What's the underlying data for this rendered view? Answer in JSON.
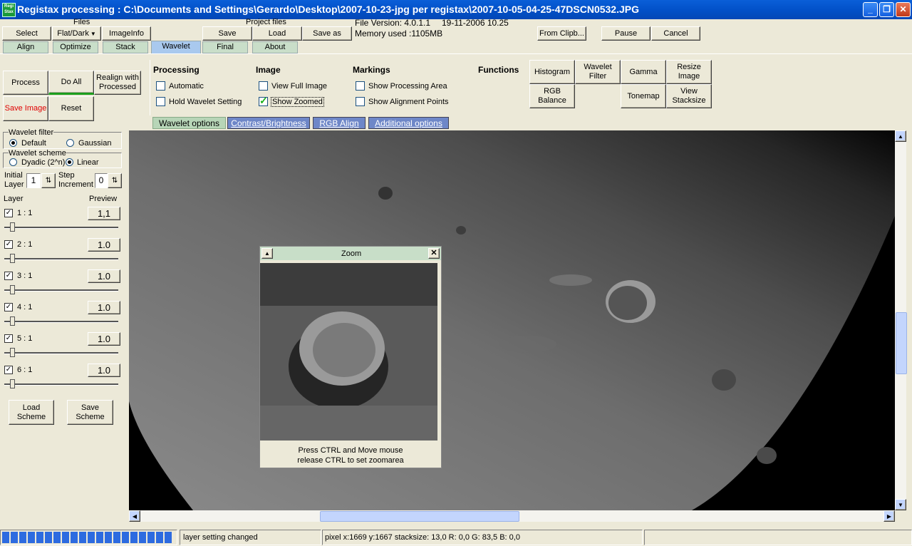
{
  "window": {
    "title": "Registax processing : C:\\Documents and Settings\\Gerardo\\Desktop\\2007-10-23-jpg per registax\\2007-10-05-04-25-47DSCN0532.JPG",
    "icon_text": "Regi Stax"
  },
  "files": {
    "group_label": "Files",
    "select": "Select",
    "flatdark": "Flat/Dark",
    "imageinfo": "ImageInfo"
  },
  "project": {
    "group_label": "Project files",
    "save": "Save",
    "load": "Load",
    "save_as": "Save as"
  },
  "info": {
    "version": "File Version: 4.0.1.1",
    "date": "19-11-2006 10.25",
    "memory": "Memory used :1105MB"
  },
  "actions": {
    "from_clip": "From Clipb...",
    "pause": "Pause",
    "cancel": "Cancel"
  },
  "tabs": [
    "Align",
    "Optimize",
    "Stack",
    "Wavelet",
    "Final",
    "About"
  ],
  "left_buttons": {
    "process": "Process",
    "do_all": "Do All",
    "realign": "Realign with Processed",
    "save_image": "Save Image",
    "reset": "Reset"
  },
  "processing": {
    "title": "Processing",
    "automatic": "Automatic",
    "hold": "Hold Wavelet Setting"
  },
  "image": {
    "title": "Image",
    "view_full": "View Full Image",
    "show_zoomed": "Show Zoomed"
  },
  "markings": {
    "title": "Markings",
    "show_area": "Show Processing Area",
    "show_align": "Show Alignment Points"
  },
  "functions": {
    "title": "Functions",
    "histogram": "Histogram",
    "wavelet_filter": "Wavelet Filter",
    "gamma": "Gamma",
    "resize": "Resize Image",
    "rgb_balance": "RGB Balance",
    "tonemap": "Tonemap",
    "view_stack": "View Stacksize"
  },
  "subtabs": [
    "Wavelet options",
    "Contrast/Brightness",
    "RGB Align",
    "Additional options"
  ],
  "wavelet_filter": {
    "label": "Wavelet filter",
    "default": "Default",
    "gaussian": "Gaussian"
  },
  "wavelet_scheme": {
    "label": "Wavelet scheme",
    "dyadic": "Dyadic (2^n)",
    "linear": "Linear"
  },
  "initial_layer": {
    "label1": "Initial",
    "label2": "Layer",
    "value": "1"
  },
  "step_increment": {
    "label1": "Step",
    "label2": "Increment",
    "value": "0"
  },
  "layers_header": {
    "layer": "Layer",
    "preview": "Preview"
  },
  "layers": [
    {
      "name": "1 : 1",
      "preview": "1,1",
      "check": "✓"
    },
    {
      "name": "2 : 1",
      "preview": "1.0",
      "check": "✓"
    },
    {
      "name": "3 : 1",
      "preview": "1.0",
      "check": "✓"
    },
    {
      "name": "4 : 1",
      "preview": "1.0",
      "check": "✓"
    },
    {
      "name": "5 : 1",
      "preview": "1.0",
      "check": "✓"
    },
    {
      "name": "6 : 1",
      "preview": "1.0",
      "check": "✓"
    }
  ],
  "scheme_buttons": {
    "load": "Load Scheme",
    "save": "Save Scheme"
  },
  "zoom": {
    "title": "Zoom",
    "hint1": "Press CTRL and Move mouse",
    "hint2": "release CTRL to set zoomarea"
  },
  "status": {
    "message": "layer setting changed",
    "pixel": "pixel x:1669 y:1667 stacksize: 13,0 R: 0,0 G: 83,5 B: 0,0"
  },
  "colors": {
    "accent": "#0A5FD8",
    "active_tab": "#A9C9EE",
    "tab": "#C9DEC9",
    "progress": "#2D6BE0"
  },
  "icons": {
    "minimize": "minimize-icon",
    "maximize": "maximize-icon",
    "close": "close-icon",
    "dropdown": "chevron-down-icon",
    "scroll": "arrow-icons"
  }
}
